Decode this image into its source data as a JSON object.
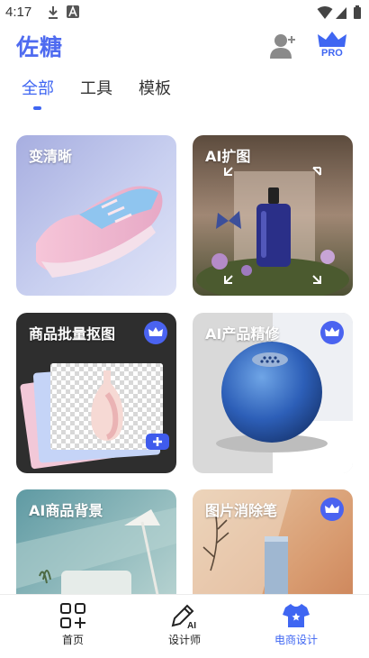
{
  "status_bar": {
    "time": "4:17"
  },
  "header": {
    "title": "佐糖",
    "pro_label": "PRO"
  },
  "tabs": [
    {
      "label": "全部",
      "active": true
    },
    {
      "label": "工具",
      "active": false
    },
    {
      "label": "模板",
      "active": false
    }
  ],
  "cards": [
    {
      "label": "变清晰",
      "crown": false
    },
    {
      "label": "AI扩图",
      "crown": false
    },
    {
      "label": "商品批量抠图",
      "crown": true
    },
    {
      "label": "AI产品精修",
      "crown": true
    },
    {
      "label": "AI商品背景",
      "crown": false
    },
    {
      "label": "图片消除笔",
      "crown": true
    }
  ],
  "bottom_nav": [
    {
      "label": "首页",
      "icon": "grid-icon",
      "active": false
    },
    {
      "label": "设计师",
      "icon": "ai-pen-icon",
      "active": false
    },
    {
      "label": "电商设计",
      "icon": "shirt-icon",
      "active": true
    }
  ],
  "colors": {
    "accent": "#3f66f2",
    "title": "#4f6bf0",
    "badge": "#4a63f0"
  }
}
